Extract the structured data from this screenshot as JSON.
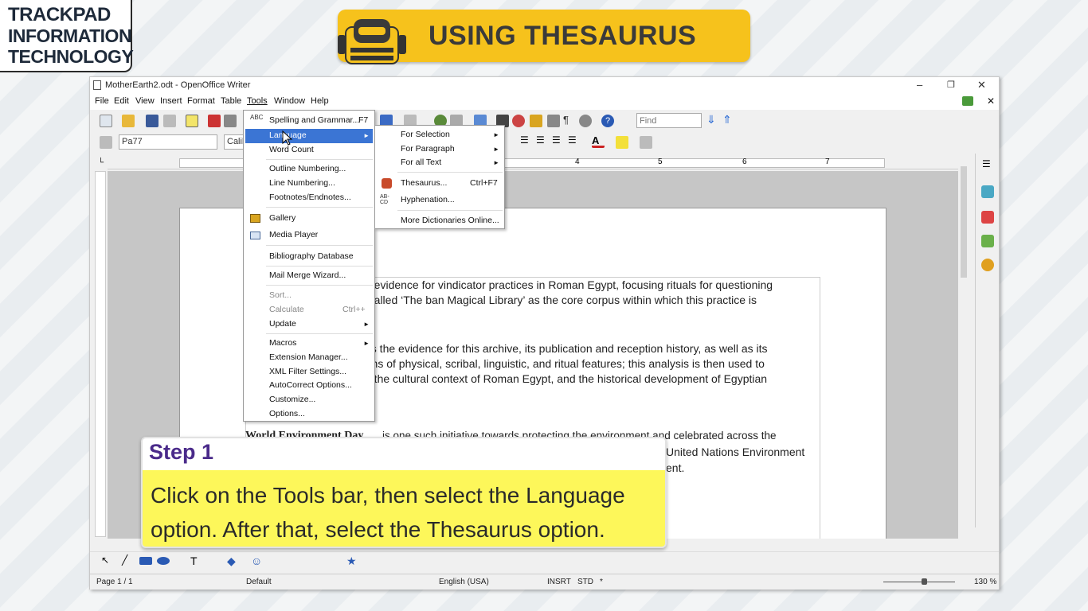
{
  "brand": {
    "line1": "TRACKPAD",
    "line2": "INFORMATION",
    "line3": "TECHNOLOGY"
  },
  "banner": {
    "title": "USING THESAURUS"
  },
  "window": {
    "title": "MotherEarth2.odt - OpenOffice Writer",
    "menus": [
      "File",
      "Edit",
      "View",
      "Insert",
      "Format",
      "Table",
      "Tools",
      "Window",
      "Help"
    ],
    "find_placeholder": "Find",
    "para_style": "Pa77",
    "font_name": "Calib"
  },
  "tools_menu": {
    "items": [
      {
        "label": "Spelling and Grammar...",
        "shortcut": "F7"
      },
      {
        "label": "Language"
      },
      {
        "label": "Word Count"
      },
      {
        "label": "Outline Numbering..."
      },
      {
        "label": "Line Numbering..."
      },
      {
        "label": "Footnotes/Endnotes..."
      },
      {
        "label": "Gallery"
      },
      {
        "label": "Media Player"
      },
      {
        "label": "Bibliography Database"
      },
      {
        "label": "Mail Merge Wizard..."
      },
      {
        "label": "Sort..."
      },
      {
        "label": "Calculate",
        "shortcut": "Ctrl++"
      },
      {
        "label": "Update"
      },
      {
        "label": "Macros"
      },
      {
        "label": "Extension Manager..."
      },
      {
        "label": "XML Filter Settings..."
      },
      {
        "label": "AutoCorrect Options..."
      },
      {
        "label": "Customize..."
      },
      {
        "label": "Options..."
      }
    ]
  },
  "language_menu": {
    "items": [
      {
        "label": "For Selection"
      },
      {
        "label": "For Paragraph"
      },
      {
        "label": "For all Text"
      },
      {
        "label": "Thesaurus...",
        "shortcut": "Ctrl+F7"
      },
      {
        "label": "Hyphenation..."
      },
      {
        "label": "More Dictionaries Online..."
      }
    ]
  },
  "document": {
    "lines": [
      "e evidence for vindicator practices in Roman Egypt, focusing rituals for questioning",
      "-called ‘The ban Magical Library’ as the core corpus within which this practice is",
      "es the evidence for this archive, its publication and reception history, as well as its",
      "rms of physical, scribal, linguistic, and ritual features; this analysis is then used to",
      "n the cultural context of Roman Egypt, and the historical development of Egyptian",
      "World Environment Day",
      " is one such initiative towards protecting the environment and celebrated across the",
      "United Nations Environment",
      "ent."
    ]
  },
  "ruler": {
    "marks": [
      "4",
      "5",
      "6",
      "7"
    ]
  },
  "status": {
    "page": "Page 1 / 1",
    "style": "Default",
    "language": "English (USA)",
    "insert": "INSRT",
    "std": "STD",
    "star": "*",
    "zoom": "130 %"
  },
  "step": {
    "heading": "Step 1",
    "body": "Click on the Tools bar, then select the Language option. After that, select the Thesaurus option."
  }
}
